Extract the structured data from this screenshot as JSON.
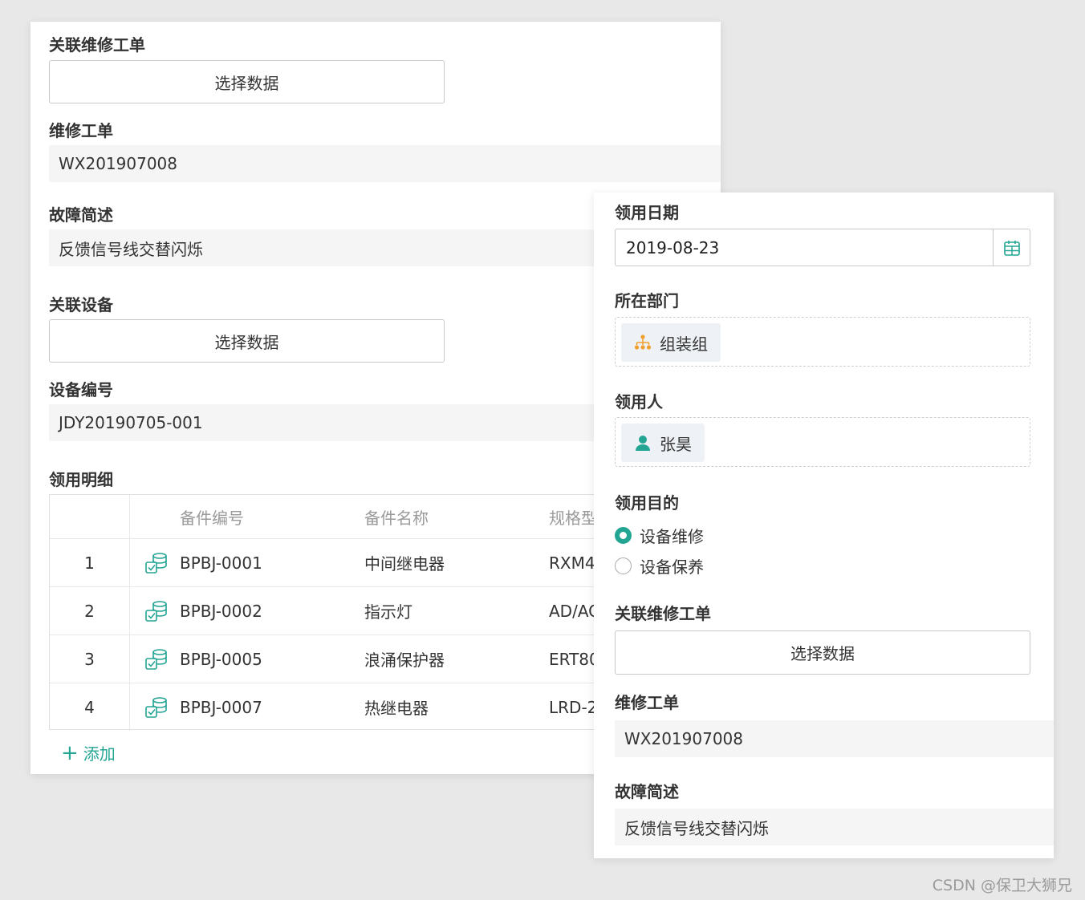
{
  "left": {
    "related_order_label": "关联维修工单",
    "related_order_button": "选择数据",
    "order_label": "维修工单",
    "order_value": "WX201907008",
    "fault_label": "故障简述",
    "fault_value": "反馈信号线交替闪烁",
    "device_label": "关联设备",
    "device_button": "选择数据",
    "device_no_label": "设备编号",
    "device_no_value": "JDY20190705-001",
    "detail_label": "领用明细",
    "table": {
      "headers": [
        "备件编号",
        "备件名称",
        "规格型"
      ],
      "rows": [
        {
          "num": "1",
          "code": "BPBJ-0001",
          "name": "中间继电器",
          "spec": "RXM4"
        },
        {
          "num": "2",
          "code": "BPBJ-0002",
          "name": "指示灯",
          "spec": "AD/AC"
        },
        {
          "num": "3",
          "code": "BPBJ-0005",
          "name": "浪涌保护器",
          "spec": "ERT80"
        },
        {
          "num": "4",
          "code": "BPBJ-0007",
          "name": "热继电器",
          "spec": "LRD-2"
        }
      ]
    },
    "add_label": "添加"
  },
  "right": {
    "date_label": "领用日期",
    "date_value": "2019-08-23",
    "dept_label": "所在部门",
    "dept_value": "组装组",
    "user_label": "领用人",
    "user_value": "张昊",
    "purpose_label": "领用目的",
    "purpose_options": [
      {
        "label": "设备维修",
        "selected": true
      },
      {
        "label": "设备保养",
        "selected": false
      }
    ],
    "related_order_label": "关联维修工单",
    "related_order_button": "选择数据",
    "order_label": "维修工单",
    "order_value": "WX201907008",
    "fault_label": "故障简述",
    "fault_value": "反馈信号线交替闪烁"
  },
  "watermark": "CSDN @保卫大狮兄",
  "colors": {
    "accent": "#23a594",
    "dept_icon": "#f0a030",
    "background": "#e8e8e8",
    "readonly_bg": "#f5f5f5"
  }
}
